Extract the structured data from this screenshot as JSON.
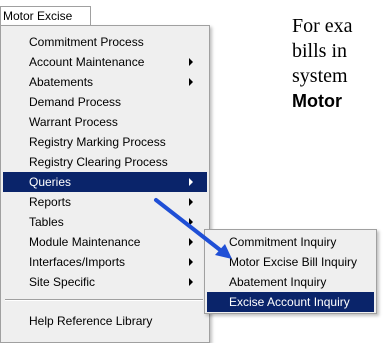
{
  "menubar": {
    "title": "Motor Excise"
  },
  "main_menu": {
    "items": [
      {
        "label": "Commitment Process"
      },
      {
        "label": "Account Maintenance",
        "submenu": true
      },
      {
        "label": "Abatements",
        "submenu": true
      },
      {
        "label": "Demand Process"
      },
      {
        "label": "Warrant Process"
      },
      {
        "label": "Registry Marking Process"
      },
      {
        "label": "Registry Clearing Process"
      },
      {
        "label": "Queries",
        "submenu": true,
        "highlighted": true
      },
      {
        "label": "Reports",
        "submenu": true
      },
      {
        "label": "Tables",
        "submenu": true
      },
      {
        "label": "Module Maintenance",
        "submenu": true
      },
      {
        "label": "Interfaces/Imports",
        "submenu": true
      },
      {
        "label": "Site Specific",
        "submenu": true
      },
      {
        "label": "Help Reference Library"
      }
    ]
  },
  "queries_submenu": {
    "items": [
      {
        "label": "Commitment Inquiry"
      },
      {
        "label": "Motor Excise Bill Inquiry"
      },
      {
        "label": "Abatement Inquiry"
      },
      {
        "label": "Excise Account Inquiry",
        "highlighted": true
      }
    ]
  },
  "doc_text": {
    "line1": "For exa",
    "line2": "bills in",
    "line3": "system",
    "line4": "Motor"
  },
  "colors": {
    "highlight": "#0a246a",
    "pointer_arrow": "#1f4fd6"
  }
}
